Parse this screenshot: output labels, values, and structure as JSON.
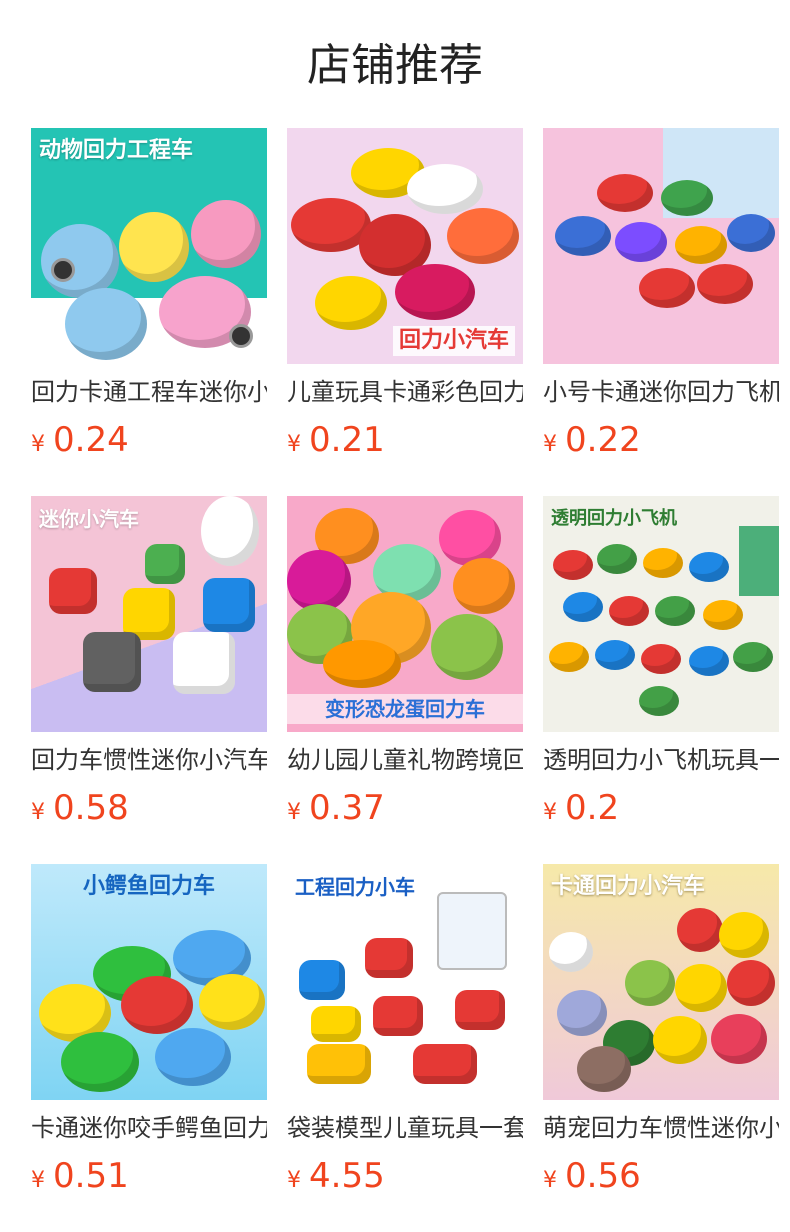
{
  "page": {
    "title": "店铺推荐",
    "currency": "¥"
  },
  "products": [
    {
      "name": "回力卡通工程车迷你小车",
      "price": "0.24",
      "banner": "动物回力工程车",
      "bg": "#24c4b4",
      "accent": "#ffd84a"
    },
    {
      "name": "儿童玩具卡通彩色回力小汽车",
      "price": "0.21",
      "banner": "回力小汽车",
      "bg": "#f2d7ee",
      "accent": "#e53935"
    },
    {
      "name": "小号卡通迷你回力飞机玩具",
      "price": "0.22",
      "banner": "",
      "bg": "#f6c3dd",
      "accent": "#3b6fd6"
    },
    {
      "name": "回力车惯性迷你小汽车方块",
      "price": "0.58",
      "banner": "迷你小汽车",
      "bg": "#f4c4d6",
      "accent": "#7a7a7a"
    },
    {
      "name": "幼儿园儿童礼物跨境回力车",
      "price": "0.37",
      "banner": "变形恐龙蛋回力车",
      "bg": "#f8a9c9",
      "accent": "#ff8f1f"
    },
    {
      "name": "透明回力小飞机玩具一套",
      "price": "0.2",
      "banner": "透明回力小飞机",
      "bg": "#f1f1e9",
      "accent": "#2bb24c"
    },
    {
      "name": "卡通迷你咬手鳄鱼回力车",
      "price": "0.51",
      "banner": "小鳄鱼回力车",
      "bg": "#7fd4f3",
      "accent": "#2fbf3e"
    },
    {
      "name": "袋装模型儿童玩具一套工程车",
      "price": "4.55",
      "banner": "工程回力小车",
      "bg": "#ffffff",
      "accent": "#2a7de1"
    },
    {
      "name": "萌宠回力车惯性迷你小汽车",
      "price": "0.56",
      "banner": "卡通回力小汽车",
      "bg": "#f6e9a9",
      "accent": "#e83f5b"
    }
  ]
}
